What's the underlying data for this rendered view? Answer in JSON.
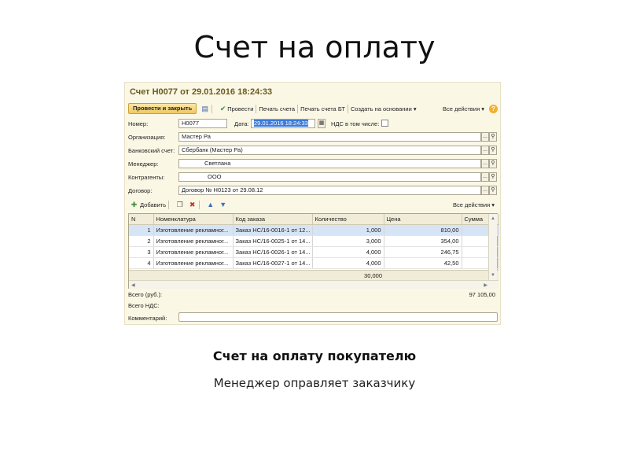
{
  "slide": {
    "title": "Счет на оплату",
    "caption_bold": "Счет на оплату покупателю",
    "caption": "Менеджер оправляет заказчику"
  },
  "window": {
    "title": "Счет Н0077 от 29.01.2016 18:24:33"
  },
  "toolbar": {
    "post_close": "Провести и закрыть",
    "post": "Провести",
    "print_invoice": "Печать счета",
    "print_invoice_bt": "Печать счета БТ",
    "create_based_on": "Создать на основании ▾",
    "all_actions": "Все действия ▾",
    "help": "?"
  },
  "form": {
    "number_label": "Номер:",
    "number_value": "Н0077",
    "date_label": "Дата:",
    "date_value": "29.01.2016 18:24:33",
    "vat_label": "НДС в том числе:",
    "org_label": "Организация:",
    "org_value": "Мастер Ра",
    "bank_label": "Банковский счет:",
    "bank_value": "Сбербанк (Мастер Ра)",
    "manager_label": "Менеджер:",
    "manager_value": "Светлана",
    "contractor_label": "Контрагенты:",
    "contractor_value": "ООО",
    "contract_label": "Договор:",
    "contract_value": "Договор № Н0123 от 29.08.12"
  },
  "table_toolbar": {
    "add": "Добавить",
    "all_actions": "Все действия ▾"
  },
  "table": {
    "columns": [
      "N",
      "Номенклатура",
      "Код заказа",
      "Количество",
      "Цена",
      "Сумма"
    ],
    "rows": [
      [
        "1",
        "Изготовление рекламног...",
        "Заказ НС/16-0016-1 от 12...",
        "1,000",
        "810,00",
        ""
      ],
      [
        "2",
        "Изготовление рекламног...",
        "Заказ НС/16-0025-1 от 14...",
        "3,000",
        "354,00",
        ""
      ],
      [
        "3",
        "Изготовление рекламног...",
        "Заказ НС/16-0026-1 от 14...",
        "4,000",
        "246,75",
        ""
      ],
      [
        "4",
        "Изготовление рекламног...",
        "Заказ НС/16-0027-1 от 14...",
        "4,000",
        "42,50",
        ""
      ]
    ],
    "footer_total_qty": "30,000"
  },
  "totals": {
    "total_label": "Всего (руб.):",
    "total_value": "97 105,00",
    "vat_label": "Всего НДС:",
    "comment_label": "Комментарий:"
  },
  "colors": {
    "window_bg": "#fbf7e5",
    "accent_button": "#f0c860",
    "selection": "#3b7ad9",
    "title_text": "#6b5a1f"
  },
  "icons": [
    "save-icon",
    "post-icon",
    "add-icon",
    "copy-icon",
    "delete-icon",
    "move-up-icon",
    "move-down-icon",
    "help-icon",
    "calendar-icon",
    "search-icon"
  ]
}
